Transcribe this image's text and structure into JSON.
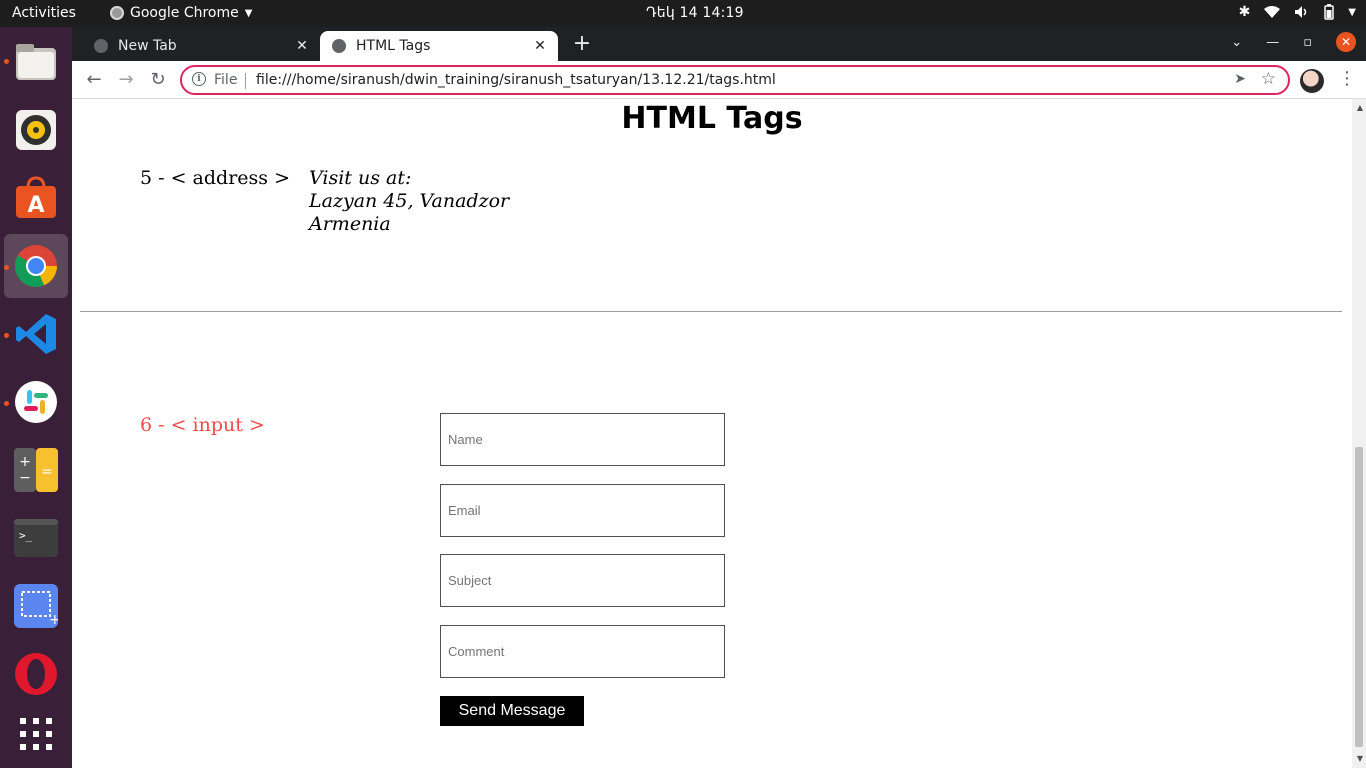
{
  "topbar": {
    "activities": "Activities",
    "app_name": "Google Chrome",
    "clock": "Դեկ 14  14:19"
  },
  "dock": {
    "items": [
      {
        "icon": "files-icon",
        "running": true
      },
      {
        "icon": "rhythmbox-icon",
        "running": false
      },
      {
        "icon": "software-center-icon",
        "running": false
      },
      {
        "icon": "chrome-icon",
        "running": true,
        "active": true
      },
      {
        "icon": "vscode-icon",
        "running": true
      },
      {
        "icon": "slack-icon",
        "running": true
      },
      {
        "icon": "calculator-icon",
        "running": false
      },
      {
        "icon": "terminal-icon",
        "running": false
      },
      {
        "icon": "screenshot-icon",
        "running": false
      },
      {
        "icon": "opera-icon",
        "running": false
      },
      {
        "icon": "app-grid-icon",
        "running": false
      }
    ]
  },
  "browser": {
    "tabs": [
      {
        "title": "New Tab",
        "active": false
      },
      {
        "title": "HTML Tags",
        "active": true
      }
    ],
    "omnibox": {
      "scheme": "File",
      "url": "file:///home/siranush/dwin_training/siranush_tsaturyan/13.12.21/tags.html"
    },
    "colors": {
      "omnibox_border": "#e0245e",
      "close_button": "#e95420"
    }
  },
  "page": {
    "title": "HTML Tags",
    "address_section": {
      "label": "5 - < address >",
      "lines": [
        "Visit us at:",
        "Lazyan 45, Vanadzor",
        "Armenia"
      ]
    },
    "input_section": {
      "label": "6 - < input >",
      "label_color": "#ef4b4b",
      "fields": [
        {
          "placeholder": "Name",
          "value": ""
        },
        {
          "placeholder": "Email",
          "value": ""
        },
        {
          "placeholder": "Subject",
          "value": ""
        },
        {
          "placeholder": "Comment",
          "value": ""
        }
      ],
      "submit_label": "Send Message"
    }
  }
}
